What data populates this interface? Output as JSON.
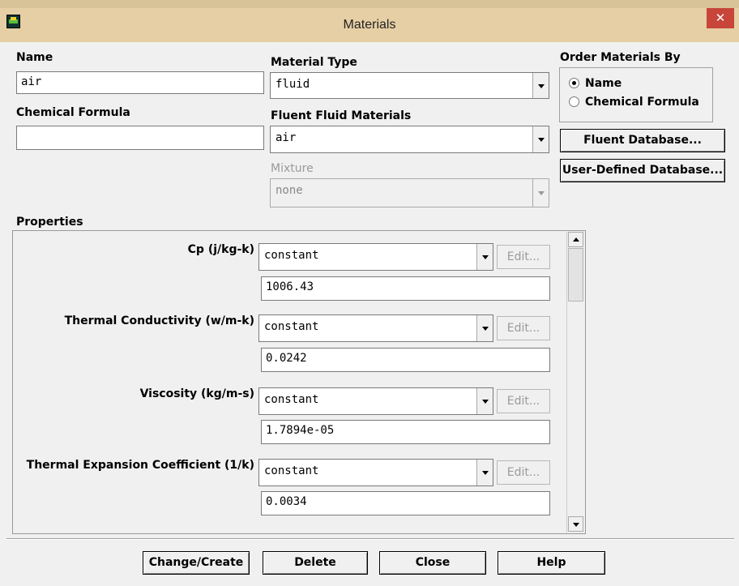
{
  "window": {
    "title": "Materials",
    "app_icon": "fluent-app-icon",
    "close_glyph": "✕"
  },
  "name": {
    "label": "Name",
    "value": "air"
  },
  "chemical_formula": {
    "label": "Chemical Formula",
    "value": ""
  },
  "material_type": {
    "label": "Material Type",
    "value": "fluid"
  },
  "fluent_fluid_materials": {
    "label": "Fluent Fluid Materials",
    "value": "air"
  },
  "mixture": {
    "label": "Mixture",
    "value": "none"
  },
  "order_by": {
    "label": "Order Materials By",
    "options": [
      {
        "label": "Name",
        "selected": true
      },
      {
        "label": "Chemical Formula",
        "selected": false
      }
    ]
  },
  "buttons": {
    "fluent_database": "Fluent Database...",
    "user_defined_database": "User-Defined Database...",
    "change_create": "Change/Create",
    "delete": "Delete",
    "close": "Close",
    "help": "Help"
  },
  "properties": {
    "label": "Properties",
    "edit_label": "Edit...",
    "items": [
      {
        "label": "Cp (j/kg-k)",
        "method": "constant",
        "value": "1006.43"
      },
      {
        "label": "Thermal Conductivity (w/m-k)",
        "method": "constant",
        "value": "0.0242"
      },
      {
        "label": "Viscosity (kg/m-s)",
        "method": "constant",
        "value": "1.7894e-05"
      },
      {
        "label": "Thermal Expansion Coefficient (1/k)",
        "method": "constant",
        "value": "0.0034"
      }
    ]
  },
  "colors": {
    "titlebar": "#e6cfa5",
    "close_button": "#c7453b",
    "background": "#f0f0f0"
  }
}
